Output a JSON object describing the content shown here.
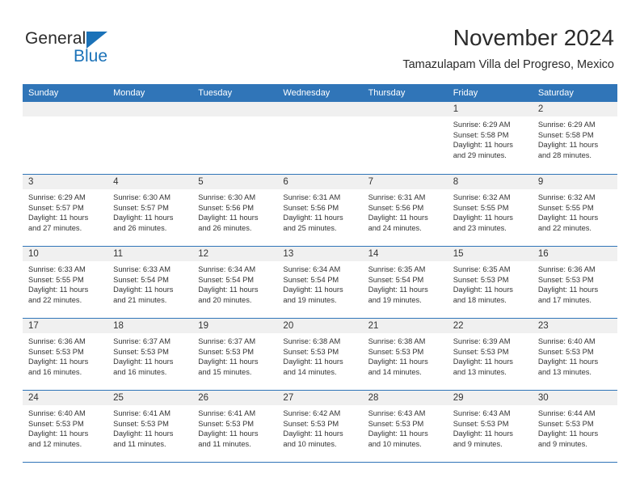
{
  "brand": {
    "name_part1": "General",
    "name_part2": "Blue",
    "flag_color": "#1b72b8"
  },
  "header": {
    "title": "November 2024",
    "subtitle": "Tamazulapam Villa del Progreso, Mexico"
  },
  "colors": {
    "header_blue": "#3075b8",
    "day_band_gray": "#f0f0f0",
    "text": "#333333"
  },
  "weekdays": [
    "Sunday",
    "Monday",
    "Tuesday",
    "Wednesday",
    "Thursday",
    "Friday",
    "Saturday"
  ],
  "weeks": [
    [
      {
        "day": "",
        "empty": true
      },
      {
        "day": "",
        "empty": true
      },
      {
        "day": "",
        "empty": true
      },
      {
        "day": "",
        "empty": true
      },
      {
        "day": "",
        "empty": true
      },
      {
        "day": "1",
        "sunrise": "Sunrise: 6:29 AM",
        "sunset": "Sunset: 5:58 PM",
        "daylight1": "Daylight: 11 hours",
        "daylight2": "and 29 minutes."
      },
      {
        "day": "2",
        "sunrise": "Sunrise: 6:29 AM",
        "sunset": "Sunset: 5:58 PM",
        "daylight1": "Daylight: 11 hours",
        "daylight2": "and 28 minutes."
      }
    ],
    [
      {
        "day": "3",
        "sunrise": "Sunrise: 6:29 AM",
        "sunset": "Sunset: 5:57 PM",
        "daylight1": "Daylight: 11 hours",
        "daylight2": "and 27 minutes."
      },
      {
        "day": "4",
        "sunrise": "Sunrise: 6:30 AM",
        "sunset": "Sunset: 5:57 PM",
        "daylight1": "Daylight: 11 hours",
        "daylight2": "and 26 minutes."
      },
      {
        "day": "5",
        "sunrise": "Sunrise: 6:30 AM",
        "sunset": "Sunset: 5:56 PM",
        "daylight1": "Daylight: 11 hours",
        "daylight2": "and 26 minutes."
      },
      {
        "day": "6",
        "sunrise": "Sunrise: 6:31 AM",
        "sunset": "Sunset: 5:56 PM",
        "daylight1": "Daylight: 11 hours",
        "daylight2": "and 25 minutes."
      },
      {
        "day": "7",
        "sunrise": "Sunrise: 6:31 AM",
        "sunset": "Sunset: 5:56 PM",
        "daylight1": "Daylight: 11 hours",
        "daylight2": "and 24 minutes."
      },
      {
        "day": "8",
        "sunrise": "Sunrise: 6:32 AM",
        "sunset": "Sunset: 5:55 PM",
        "daylight1": "Daylight: 11 hours",
        "daylight2": "and 23 minutes."
      },
      {
        "day": "9",
        "sunrise": "Sunrise: 6:32 AM",
        "sunset": "Sunset: 5:55 PM",
        "daylight1": "Daylight: 11 hours",
        "daylight2": "and 22 minutes."
      }
    ],
    [
      {
        "day": "10",
        "sunrise": "Sunrise: 6:33 AM",
        "sunset": "Sunset: 5:55 PM",
        "daylight1": "Daylight: 11 hours",
        "daylight2": "and 22 minutes."
      },
      {
        "day": "11",
        "sunrise": "Sunrise: 6:33 AM",
        "sunset": "Sunset: 5:54 PM",
        "daylight1": "Daylight: 11 hours",
        "daylight2": "and 21 minutes."
      },
      {
        "day": "12",
        "sunrise": "Sunrise: 6:34 AM",
        "sunset": "Sunset: 5:54 PM",
        "daylight1": "Daylight: 11 hours",
        "daylight2": "and 20 minutes."
      },
      {
        "day": "13",
        "sunrise": "Sunrise: 6:34 AM",
        "sunset": "Sunset: 5:54 PM",
        "daylight1": "Daylight: 11 hours",
        "daylight2": "and 19 minutes."
      },
      {
        "day": "14",
        "sunrise": "Sunrise: 6:35 AM",
        "sunset": "Sunset: 5:54 PM",
        "daylight1": "Daylight: 11 hours",
        "daylight2": "and 19 minutes."
      },
      {
        "day": "15",
        "sunrise": "Sunrise: 6:35 AM",
        "sunset": "Sunset: 5:53 PM",
        "daylight1": "Daylight: 11 hours",
        "daylight2": "and 18 minutes."
      },
      {
        "day": "16",
        "sunrise": "Sunrise: 6:36 AM",
        "sunset": "Sunset: 5:53 PM",
        "daylight1": "Daylight: 11 hours",
        "daylight2": "and 17 minutes."
      }
    ],
    [
      {
        "day": "17",
        "sunrise": "Sunrise: 6:36 AM",
        "sunset": "Sunset: 5:53 PM",
        "daylight1": "Daylight: 11 hours",
        "daylight2": "and 16 minutes."
      },
      {
        "day": "18",
        "sunrise": "Sunrise: 6:37 AM",
        "sunset": "Sunset: 5:53 PM",
        "daylight1": "Daylight: 11 hours",
        "daylight2": "and 16 minutes."
      },
      {
        "day": "19",
        "sunrise": "Sunrise: 6:37 AM",
        "sunset": "Sunset: 5:53 PM",
        "daylight1": "Daylight: 11 hours",
        "daylight2": "and 15 minutes."
      },
      {
        "day": "20",
        "sunrise": "Sunrise: 6:38 AM",
        "sunset": "Sunset: 5:53 PM",
        "daylight1": "Daylight: 11 hours",
        "daylight2": "and 14 minutes."
      },
      {
        "day": "21",
        "sunrise": "Sunrise: 6:38 AM",
        "sunset": "Sunset: 5:53 PM",
        "daylight1": "Daylight: 11 hours",
        "daylight2": "and 14 minutes."
      },
      {
        "day": "22",
        "sunrise": "Sunrise: 6:39 AM",
        "sunset": "Sunset: 5:53 PM",
        "daylight1": "Daylight: 11 hours",
        "daylight2": "and 13 minutes."
      },
      {
        "day": "23",
        "sunrise": "Sunrise: 6:40 AM",
        "sunset": "Sunset: 5:53 PM",
        "daylight1": "Daylight: 11 hours",
        "daylight2": "and 13 minutes."
      }
    ],
    [
      {
        "day": "24",
        "sunrise": "Sunrise: 6:40 AM",
        "sunset": "Sunset: 5:53 PM",
        "daylight1": "Daylight: 11 hours",
        "daylight2": "and 12 minutes."
      },
      {
        "day": "25",
        "sunrise": "Sunrise: 6:41 AM",
        "sunset": "Sunset: 5:53 PM",
        "daylight1": "Daylight: 11 hours",
        "daylight2": "and 11 minutes."
      },
      {
        "day": "26",
        "sunrise": "Sunrise: 6:41 AM",
        "sunset": "Sunset: 5:53 PM",
        "daylight1": "Daylight: 11 hours",
        "daylight2": "and 11 minutes."
      },
      {
        "day": "27",
        "sunrise": "Sunrise: 6:42 AM",
        "sunset": "Sunset: 5:53 PM",
        "daylight1": "Daylight: 11 hours",
        "daylight2": "and 10 minutes."
      },
      {
        "day": "28",
        "sunrise": "Sunrise: 6:43 AM",
        "sunset": "Sunset: 5:53 PM",
        "daylight1": "Daylight: 11 hours",
        "daylight2": "and 10 minutes."
      },
      {
        "day": "29",
        "sunrise": "Sunrise: 6:43 AM",
        "sunset": "Sunset: 5:53 PM",
        "daylight1": "Daylight: 11 hours",
        "daylight2": "and 9 minutes."
      },
      {
        "day": "30",
        "sunrise": "Sunrise: 6:44 AM",
        "sunset": "Sunset: 5:53 PM",
        "daylight1": "Daylight: 11 hours",
        "daylight2": "and 9 minutes."
      }
    ]
  ]
}
